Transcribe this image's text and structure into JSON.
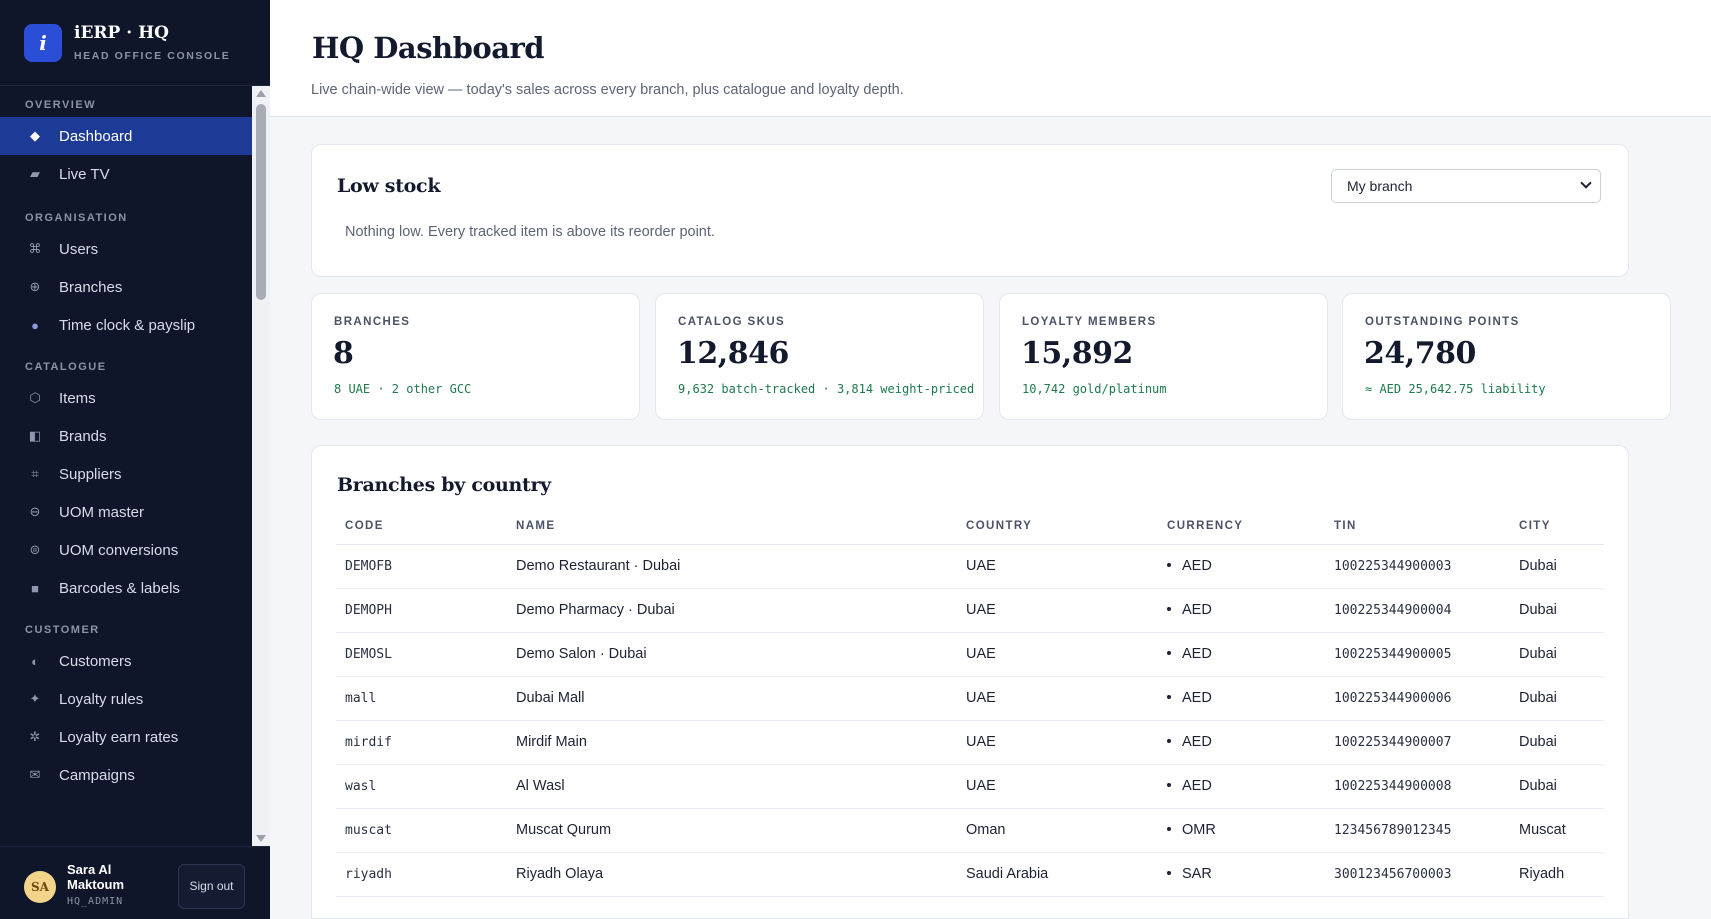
{
  "brand": {
    "logo_letter": "i",
    "name": "iERP · HQ",
    "subtitle": "HEAD OFFICE CONSOLE"
  },
  "sidebar": {
    "sections": [
      {
        "label": "OVERVIEW",
        "items": [
          {
            "label": "Dashboard",
            "icon": "diamond-icon",
            "active": true
          },
          {
            "label": "Live TV",
            "icon": "tv-icon"
          }
        ]
      },
      {
        "label": "ORGANISATION",
        "items": [
          {
            "label": "Users",
            "icon": "command-icon"
          },
          {
            "label": "Branches",
            "icon": "globe-icon"
          },
          {
            "label": "Time clock & payslip",
            "icon": "clock-icon"
          }
        ]
      },
      {
        "label": "CATALOGUE",
        "items": [
          {
            "label": "Items",
            "icon": "box-icon"
          },
          {
            "label": "Brands",
            "icon": "brand-icon"
          },
          {
            "label": "Suppliers",
            "icon": "frame-icon"
          },
          {
            "label": "UOM master",
            "icon": "uom-icon"
          },
          {
            "label": "UOM conversions",
            "icon": "conversion-icon"
          },
          {
            "label": "Barcodes & labels",
            "icon": "barcode-icon"
          }
        ]
      },
      {
        "label": "CUSTOMER",
        "items": [
          {
            "label": "Customers",
            "icon": "half-circle-icon"
          },
          {
            "label": "Loyalty rules",
            "icon": "sparkle-icon"
          },
          {
            "label": "Loyalty earn rates",
            "icon": "gear-icon"
          },
          {
            "label": "Campaigns",
            "icon": "mail-icon"
          }
        ]
      }
    ]
  },
  "user": {
    "initials": "SA",
    "name": "Sara Al Maktoum",
    "role": "HQ_ADMIN",
    "signout_label": "Sign out"
  },
  "page": {
    "title": "HQ Dashboard",
    "subtitle": "Live chain-wide view — today's sales across every branch, plus catalogue and loyalty depth."
  },
  "low_stock": {
    "title": "Low stock",
    "message": "Nothing low. Every tracked item is above its reorder point.",
    "branch_select": "My branch"
  },
  "stats": [
    {
      "label": "BRANCHES",
      "value": "8",
      "note": "8 UAE · 2 other GCC"
    },
    {
      "label": "CATALOG SKUS",
      "value": "12,846",
      "note": "9,632 batch-tracked · 3,814 weight-priced"
    },
    {
      "label": "LOYALTY MEMBERS",
      "value": "15,892",
      "note": "10,742 gold/platinum"
    },
    {
      "label": "OUTSTANDING POINTS",
      "value": "24,780",
      "note": "≈ AED 25,642.75 liability"
    }
  ],
  "branches": {
    "title": "Branches by country",
    "columns": [
      "CODE",
      "NAME",
      "COUNTRY",
      "CURRENCY",
      "TIN",
      "CITY"
    ],
    "rows": [
      {
        "code": "DEMOFB",
        "name": "Demo Restaurant · Dubai",
        "country": "UAE",
        "currency": "AED",
        "tin": "100225344900003",
        "city": "Dubai"
      },
      {
        "code": "DEMOPH",
        "name": "Demo Pharmacy · Dubai",
        "country": "UAE",
        "currency": "AED",
        "tin": "100225344900004",
        "city": "Dubai"
      },
      {
        "code": "DEMOSL",
        "name": "Demo Salon · Dubai",
        "country": "UAE",
        "currency": "AED",
        "tin": "100225344900005",
        "city": "Dubai"
      },
      {
        "code": "mall",
        "name": "Dubai Mall",
        "country": "UAE",
        "currency": "AED",
        "tin": "100225344900006",
        "city": "Dubai"
      },
      {
        "code": "mirdif",
        "name": "Mirdif Main",
        "country": "UAE",
        "currency": "AED",
        "tin": "100225344900007",
        "city": "Dubai"
      },
      {
        "code": "wasl",
        "name": "Al Wasl",
        "country": "UAE",
        "currency": "AED",
        "tin": "100225344900008",
        "city": "Dubai"
      },
      {
        "code": "muscat",
        "name": "Muscat Qurum",
        "country": "Oman",
        "currency": "OMR",
        "tin": "123456789012345",
        "city": "Muscat"
      },
      {
        "code": "riyadh",
        "name": "Riyadh Olaya",
        "country": "Saudi Arabia",
        "currency": "SAR",
        "tin": "300123456700003",
        "city": "Riyadh"
      }
    ]
  }
}
